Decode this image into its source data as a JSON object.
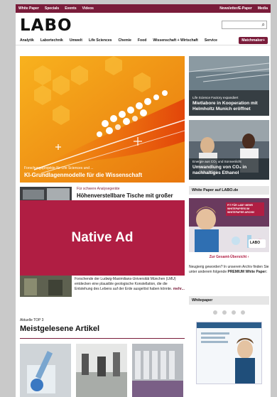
{
  "topbar": {
    "left": [
      "White Paper",
      "Specials",
      "Events",
      "Videos"
    ],
    "right": [
      "Newsletter/E-Paper",
      "Media"
    ]
  },
  "logo": "LABO",
  "search": {
    "icon": "search-icon"
  },
  "nav": [
    "Analytik",
    "Labortechnik",
    "Umwelt",
    "Life Sciences",
    "Chemie",
    "Food",
    "Wissenschaft + Wirtschaft",
    "Service",
    "Matchmaker+"
  ],
  "hero": {
    "kicker": "Forschungsprojekte für Life Sciences und ...",
    "title": "KI-Grundlagenmodelle für die Wissenschaft"
  },
  "side": [
    {
      "kicker": "Life Science Factory expandiert",
      "title": "Mietlabore in Kooperation mit Helmholtz Munich eröffnet"
    },
    {
      "kicker": "Energie aus CO₂ und Sonnenlicht",
      "title": "Umwandlung von CO₂ in nachhaltiges Ethanol"
    }
  ],
  "article": {
    "kicker": "Für schwere Analysegeräte",
    "title": "Höhenverstellbare Tische mit großer"
  },
  "native_ad": "Native Ad",
  "article2": {
    "text": "Forschende der Ludwig-Maximilians-Universität München (LMU) entdecken eine plausible geologische Konstellation, die die Entstehung des Lebens auf der Erde ausgelöst haben könnte.",
    "more": "mehr..."
  },
  "whitepaper_box": {
    "heading": "White Paper auf LABO.de",
    "ad_badge": "FIT FÜR LAB? MEHR WHITEPAPERS IM WHITEPAPER ARCHIV",
    "ad_logo": "LABO",
    "link": "Zur Gesamt-Übersicht ›",
    "text_plain": "Neugierig geworden? In unserem Archiv finden Sie unter anderem folgende",
    "text_bold": "PREMIUM White Paper:"
  },
  "whitepaper2": {
    "heading": "Whitepaper"
  },
  "top3": {
    "kicker": "Aktuelle TOP 3",
    "title": "Meistgelesene Artikel"
  },
  "colors": {
    "brand": "#7a1c3a",
    "native": "#b01e43",
    "hero": "#f29b15"
  }
}
